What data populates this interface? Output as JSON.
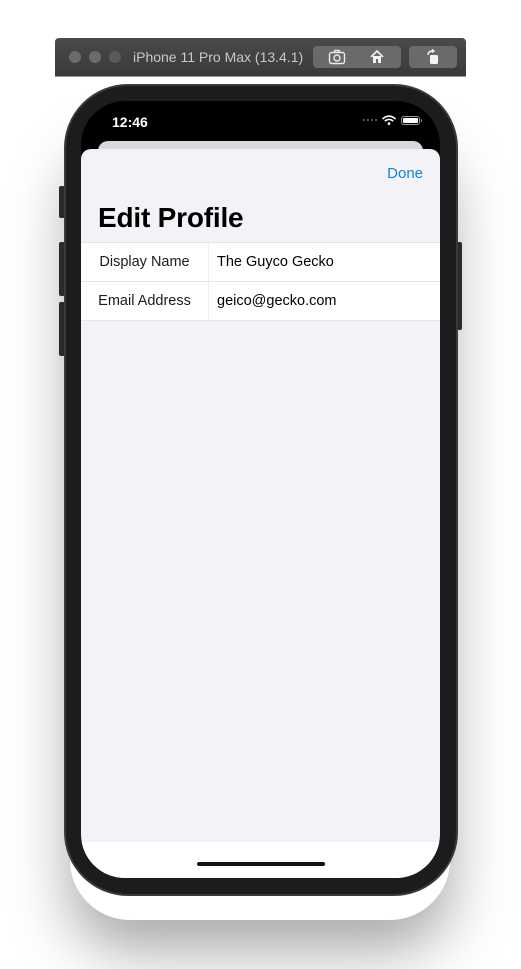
{
  "simulator": {
    "title": "iPhone 11 Pro Max (13.4.1)",
    "buttons": {
      "screenshot": "camera-icon",
      "home": "home-icon",
      "rotate": "rotate-icon"
    }
  },
  "status_bar": {
    "time": "12:46",
    "icons": [
      "signal-icon",
      "wifi-icon",
      "battery-icon"
    ]
  },
  "nav": {
    "done_label": "Done",
    "title": "Edit Profile"
  },
  "form": {
    "rows": [
      {
        "label": "Display Name",
        "value": "The Guyco Gecko"
      },
      {
        "label": "Email Address",
        "value": "geico@gecko.com"
      }
    ]
  },
  "colors": {
    "accent": "#1a7ede",
    "sheet_background": "#f2f2f7",
    "cell_background": "#ffffff",
    "separator": "#e4e4e9"
  }
}
